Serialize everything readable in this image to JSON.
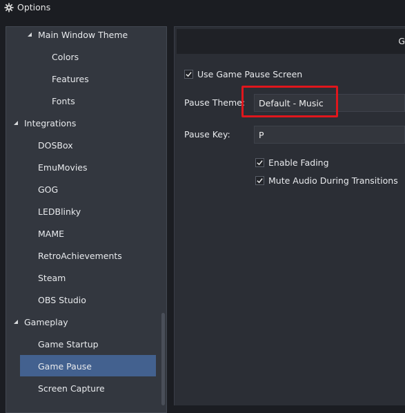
{
  "window": {
    "title": "Options",
    "icon": "gear-icon"
  },
  "sidebar": {
    "items": [
      {
        "label": "Main Window Theme",
        "expanded": true
      },
      {
        "label": "Colors"
      },
      {
        "label": "Features"
      },
      {
        "label": "Fonts"
      },
      {
        "label": "Integrations",
        "expanded": true
      },
      {
        "label": "DOSBox"
      },
      {
        "label": "EmuMovies"
      },
      {
        "label": "GOG"
      },
      {
        "label": "LEDBlinky"
      },
      {
        "label": "MAME"
      },
      {
        "label": "RetroAchievements"
      },
      {
        "label": "Steam"
      },
      {
        "label": "OBS Studio"
      },
      {
        "label": "Gameplay",
        "expanded": true
      },
      {
        "label": "Game Startup"
      },
      {
        "label": "Game Pause",
        "selected": true
      },
      {
        "label": "Screen Capture"
      }
    ]
  },
  "header": {
    "text": "G"
  },
  "settings": {
    "use_game_pause_screen": {
      "label": "Use Game Pause Screen",
      "checked": true
    },
    "pause_theme": {
      "label": "Pause Theme:",
      "value": "Default - Music"
    },
    "pause_key": {
      "label": "Pause Key:",
      "value": "P"
    },
    "enable_fading": {
      "label": "Enable Fading",
      "checked": true
    },
    "mute_audio": {
      "label": "Mute Audio During Transitions",
      "checked": true
    }
  },
  "colors": {
    "selection": "#43618f",
    "highlight": "#e0161c"
  }
}
